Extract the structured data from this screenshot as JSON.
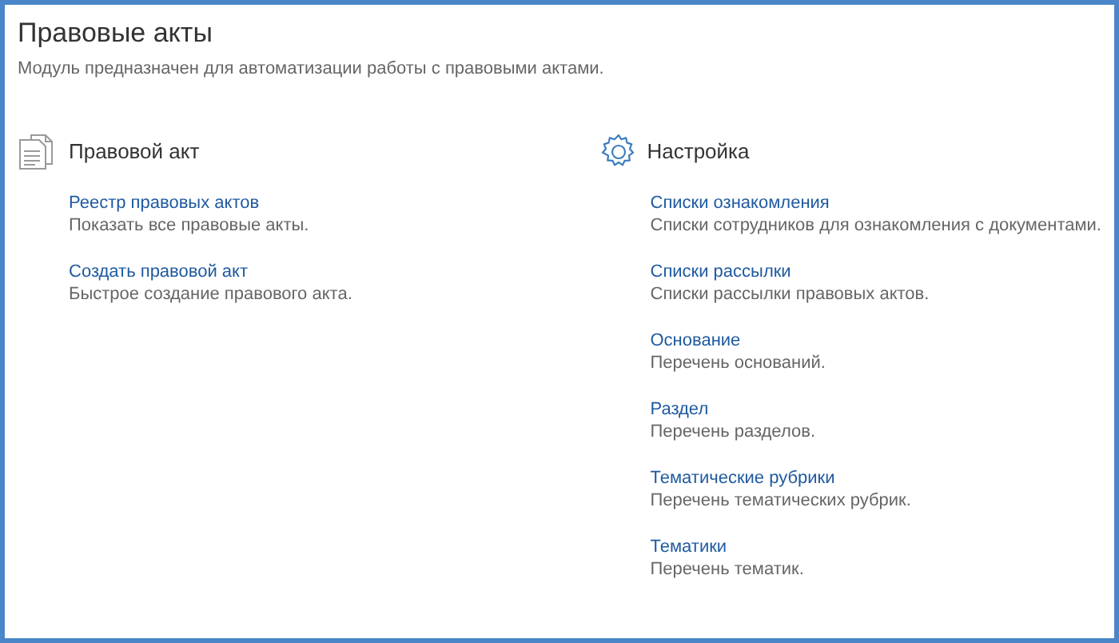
{
  "page": {
    "title": "Правовые акты",
    "description": "Модуль предназначен для автоматизации работы с правовыми актами."
  },
  "sections": [
    {
      "kind": "document",
      "title": "Правовой акт",
      "items": [
        {
          "link": "Реестр правовых актов",
          "description": "Показать все правовые акты."
        },
        {
          "link": "Создать правовой акт",
          "description": "Быстрое создание правового акта."
        }
      ]
    },
    {
      "kind": "settings",
      "title": "Настройка",
      "items": [
        {
          "link": "Списки ознакомления",
          "description": "Списки сотрудников для ознакомления с документами."
        },
        {
          "link": "Списки рассылки",
          "description": "Списки рассылки правовых актов."
        },
        {
          "link": "Основание",
          "description": "Перечень оснований."
        },
        {
          "link": "Раздел",
          "description": "Перечень разделов."
        },
        {
          "link": "Тематические рубрики",
          "description": "Перечень тематических рубрик."
        },
        {
          "link": "Тематики",
          "description": "Перечень тематик."
        }
      ]
    }
  ]
}
